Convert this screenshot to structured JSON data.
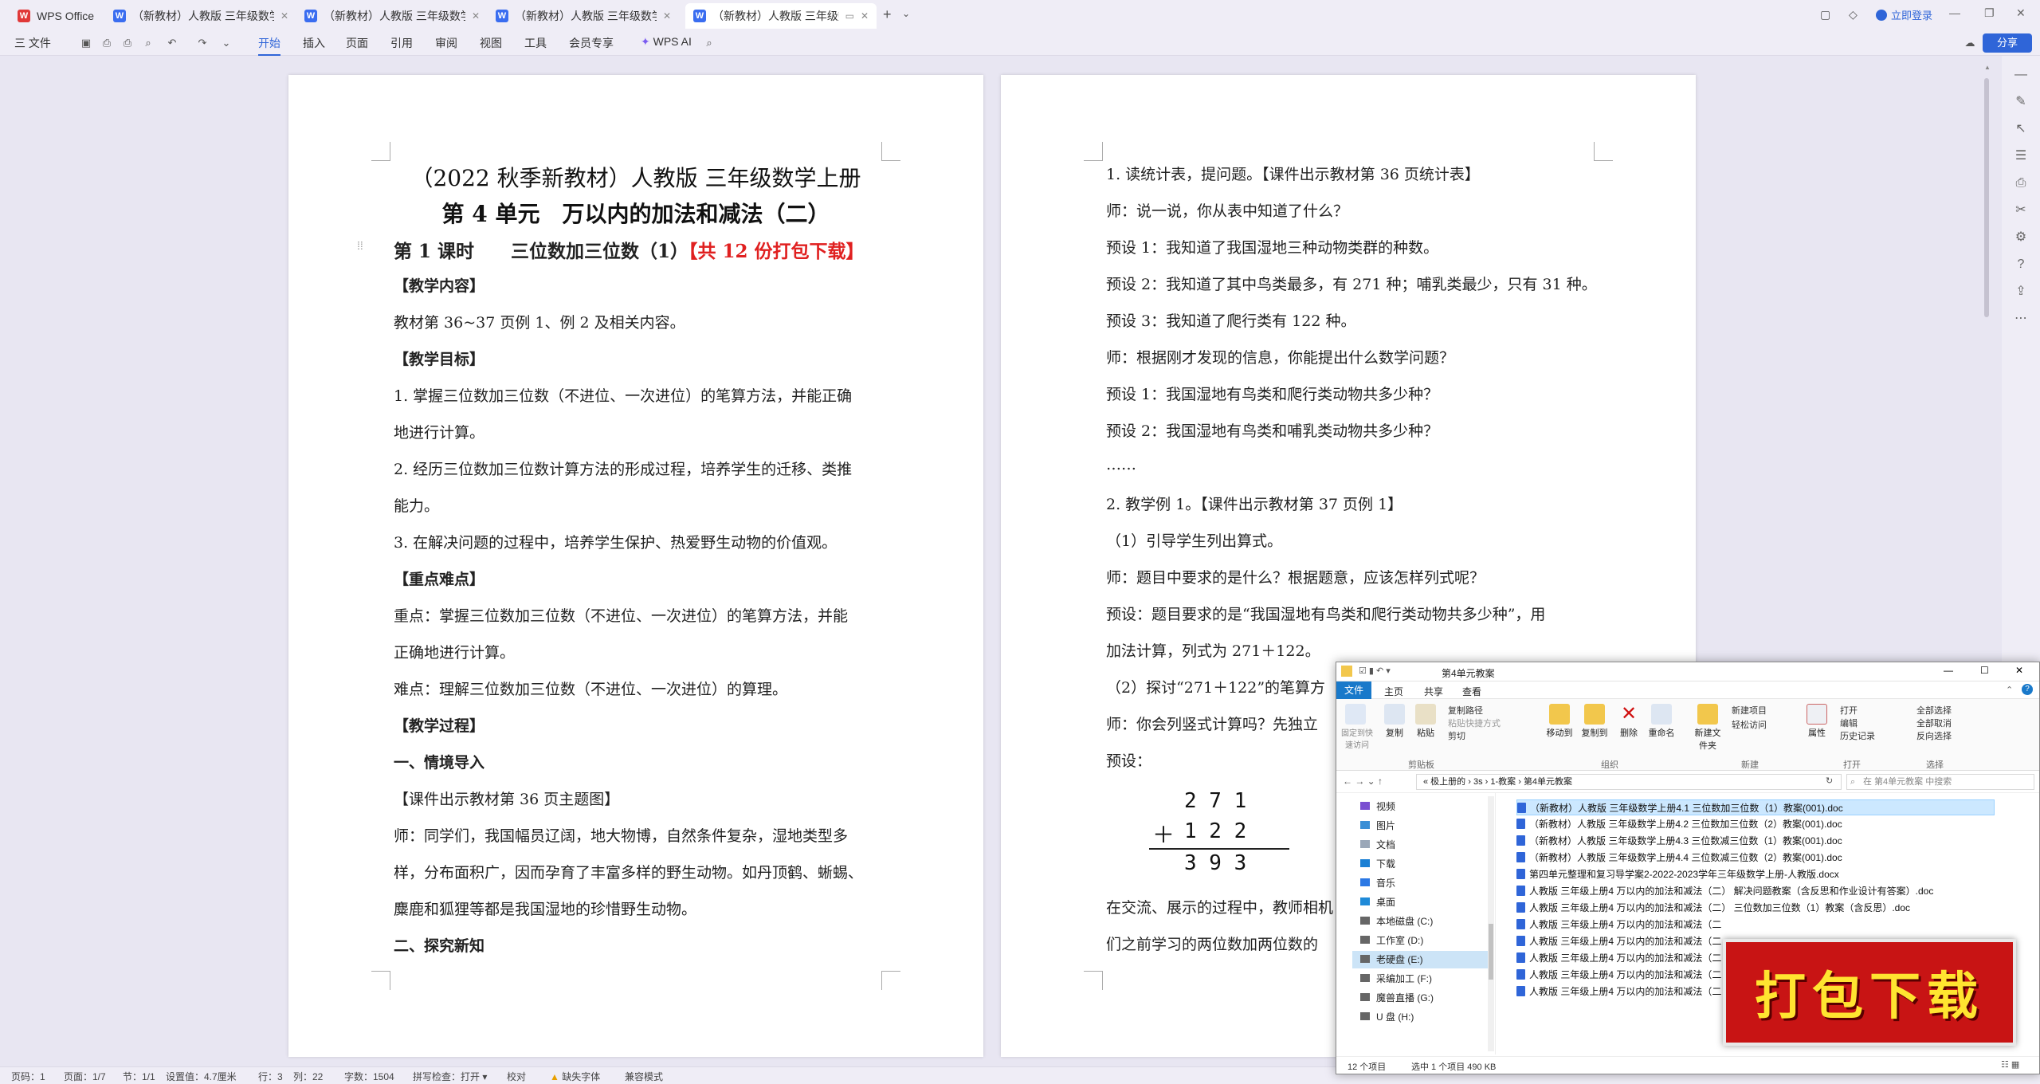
{
  "tabs": [
    {
      "label": "WPS Office",
      "kind": "wps"
    },
    {
      "label": "（新教材）人教版 三年级数学上册",
      "kind": "w"
    },
    {
      "label": "（新教材）人教版 三年级数学上册",
      "kind": "w"
    },
    {
      "label": "（新教材）人教版 三年级数学上册",
      "kind": "w"
    },
    {
      "label": "（新教材）人教版 三年级数学",
      "kind": "w"
    }
  ],
  "titlebar": {
    "login": "立即登录",
    "share": "分享"
  },
  "menu": {
    "file": "三 文件",
    "items": [
      "开始",
      "插入",
      "页面",
      "引用",
      "审阅",
      "视图",
      "工具",
      "会员专享"
    ],
    "ai": "WPS AI"
  },
  "page1": {
    "title1": "（2022 秋季新教材）人教版 三年级数学上册",
    "title2": "第 4 单元　万以内的加法和减法（二）",
    "lesson_pre": "第 1 课时　　三位数加三位数（1）",
    "lesson_red": "【共 12 份打包下载】",
    "lines": [
      {
        "t": "【教学内容】",
        "b": true
      },
      {
        "t": "教材第 36~37 页例 1、例 2 及相关内容。",
        "b": false
      },
      {
        "t": "【教学目标】",
        "b": true
      },
      {
        "t": "1. 掌握三位数加三位数（不进位、一次进位）的笔算方法，并能正确",
        "b": false
      },
      {
        "t": "地进行计算。",
        "b": false
      },
      {
        "t": "2. 经历三位数加三位数计算方法的形成过程，培养学生的迁移、类推",
        "b": false
      },
      {
        "t": "能力。",
        "b": false
      },
      {
        "t": "3. 在解决问题的过程中，培养学生保护、热爱野生动物的价值观。",
        "b": false
      },
      {
        "t": "【重点难点】",
        "b": true
      },
      {
        "t": "重点：掌握三位数加三位数（不进位、一次进位）的笔算方法，并能",
        "b": false
      },
      {
        "t": "正确地进行计算。",
        "b": false
      },
      {
        "t": "难点：理解三位数加三位数（不进位、一次进位）的算理。",
        "b": false
      },
      {
        "t": "【教学过程】",
        "b": true
      },
      {
        "t": "一、情境导入",
        "b": true
      },
      {
        "t": "【课件出示教材第 36 页主题图】",
        "b": false
      },
      {
        "t": "师：同学们，我国幅员辽阔，地大物博，自然条件复杂，湿地类型多",
        "b": false
      },
      {
        "t": "样，分布面积广，因而孕育了丰富多样的野生动物。如丹顶鹤、蜥蜴、",
        "b": false
      },
      {
        "t": "麋鹿和狐狸等都是我国湿地的珍惜野生动物。",
        "b": false
      },
      {
        "t": "二、探究新知",
        "b": true
      }
    ]
  },
  "page2": {
    "lines": [
      "1. 读统计表，提问题。【课件出示教材第 36 页统计表】",
      "师：说一说，你从表中知道了什么？",
      "预设 1：我知道了我国湿地三种动物类群的种数。",
      "预设 2：我知道了其中鸟类最多，有 271 种；哺乳类最少，只有 31 种。",
      "预设 3：我知道了爬行类有 122 种。",
      "师：根据刚才发现的信息，你能提出什么数学问题？",
      "预设 1：我国湿地有鸟类和爬行类动物共多少种？",
      "预设 2：我国湿地有鸟类和哺乳类动物共多少种？",
      "……",
      "2. 教学例 1。【课件出示教材第 37 页例 1】",
      "（1）引导学生列出算式。",
      "师：题目中要求的是什么？根据题意，应该怎样列式呢？",
      "预设：题目要求的是“我国湿地有鸟类和爬行类动物共多少种”，用",
      "加法计算，列式为 271＋122。",
      "（2）探讨“271＋122”的笔算方",
      "师：你会列竖式计算吗？先独立",
      "预设："
    ],
    "calc_row1": "2 7 1",
    "calc_op": "＋",
    "calc_row2": "1 2 2",
    "calc_res": "3 9 3",
    "after1": "在交流、展示的过程中，教师相机",
    "after2": "们之前学习的两位数加两位数的"
  },
  "explorer": {
    "title": "第4单元教案",
    "ribbon_tabs": [
      "文件",
      "主页",
      "共享",
      "查看"
    ],
    "groups": [
      "剪贴板",
      "组织",
      "新建",
      "打开",
      "选择"
    ],
    "buttons": {
      "pin": "固定到快速访问",
      "copy": "复制",
      "paste": "粘贴",
      "copypath": "复制路径",
      "pasteshort": "粘贴快捷方式",
      "cut": "剪切",
      "move": "移动到",
      "copyto": "复制到",
      "delete": "删除",
      "rename": "重命名",
      "newfolder": "新建文件夹",
      "newitem": "新建项目",
      "easyaccess": "轻松访问",
      "props": "属性",
      "open": "打开",
      "edit": "编辑",
      "history": "历史记录",
      "selectall": "全部选择",
      "selectnone": "全部取消",
      "invert": "反向选择"
    },
    "path": [
      "« 极上册的",
      "3s",
      "1-教案",
      "第4单元教案"
    ],
    "search_placeholder": "在 第4单元教案 中搜索",
    "nav": [
      "视频",
      "图片",
      "文档",
      "下载",
      "音乐",
      "桌面",
      "本地磁盘 (C:)",
      "工作室 (D:)",
      "老硬盘 (E:)",
      "采编加工 (F:)",
      "魔兽直播 (G:)",
      "U 盘 (H:)"
    ],
    "nav_selected": 8,
    "files": [
      "（新教材）人教版 三年级数学上册4.1  三位数加三位数（1）教案(001).doc",
      "（新教材）人教版 三年级数学上册4.2  三位数加三位数（2）教案(001).doc",
      "（新教材）人教版 三年级数学上册4.3  三位数减三位数（1）教案(001).doc",
      "（新教材）人教版 三年级数学上册4.4  三位数减三位数（2）教案(001).doc",
      "第四单元整理和复习导学案2-2022-2023学年三年级数学上册-人教版.docx",
      "人教版 三年级上册4 万以内的加法和减法（二） 解决问题教案（含反思和作业设计有答案）.doc",
      "人教版 三年级上册4 万以内的加法和减法（二） 三位数加三位数（1）教案（含反思）.doc",
      "人教版 三年级上册4 万以内的加法和减法（二",
      "人教版 三年级上册4 万以内的加法和减法（二",
      "人教版 三年级上册4 万以内的加法和减法（二",
      "人教版 三年级上册4 万以内的加法和减法（二",
      "人教版 三年级上册4 万以内的加法和减法（二"
    ],
    "status_count": "12 个项目",
    "status_sel": "选中 1 个项目  490 KB"
  },
  "promo": "打包下载",
  "status": {
    "items": [
      "页码：1",
      "页面：1/7",
      "节：1/1",
      "设置值：4.7厘米",
      "行：3",
      "列：22",
      "字数：1504",
      "拼写检查：打开 ▾",
      "校对",
      "缺失字体",
      "兼容模式"
    ]
  },
  "colors": {
    "accent": "#2f65d8",
    "red": "#e02020",
    "promo_bg": "#c81414",
    "promo_text": "#ffe430"
  }
}
